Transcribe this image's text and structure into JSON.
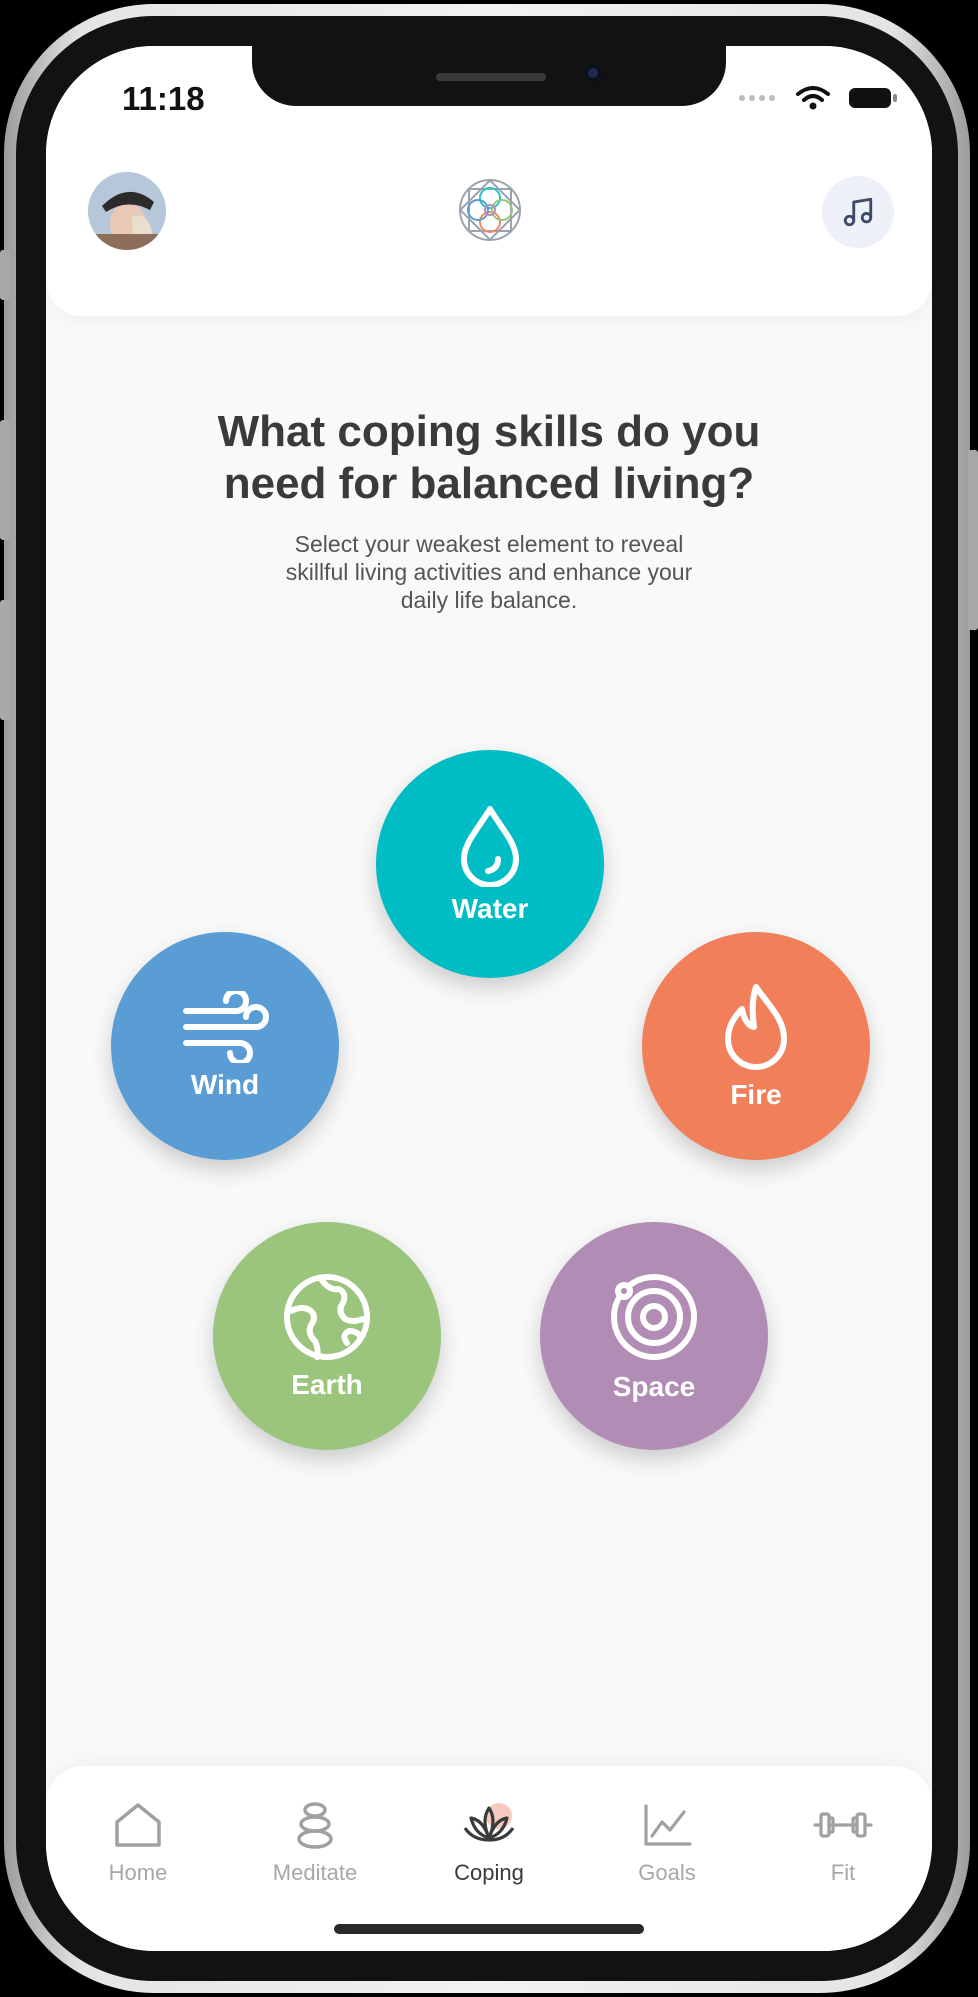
{
  "status_bar": {
    "time": "11:18"
  },
  "header": {
    "avatar": "user-avatar",
    "logo": "mandala-logo",
    "music_icon": "music-note-icon"
  },
  "main": {
    "title_line1": "What coping skills do you",
    "title_line2": "need for balanced living?",
    "subtitle_line1": "Select your weakest element to reveal",
    "subtitle_line2": "skillful living activities and enhance your",
    "subtitle_line3": "daily life balance."
  },
  "elements": [
    {
      "label": "Water",
      "color": "#00bcc4",
      "icon": "water-drop-icon"
    },
    {
      "label": "Wind",
      "color": "#5a9dd5",
      "icon": "wind-icon"
    },
    {
      "label": "Fire",
      "color": "#f07f5a",
      "icon": "flame-icon"
    },
    {
      "label": "Earth",
      "color": "#9bc47d",
      "icon": "globe-icon"
    },
    {
      "label": "Space",
      "color": "#b18db5",
      "icon": "orbit-icon"
    }
  ],
  "tabs": [
    {
      "label": "Home",
      "icon": "home-icon",
      "active": false
    },
    {
      "label": "Meditate",
      "icon": "stones-icon",
      "active": false
    },
    {
      "label": "Coping",
      "icon": "lotus-icon",
      "active": true
    },
    {
      "label": "Goals",
      "icon": "chart-icon",
      "active": false
    },
    {
      "label": "Fit",
      "icon": "dumbbell-icon",
      "active": false
    }
  ]
}
